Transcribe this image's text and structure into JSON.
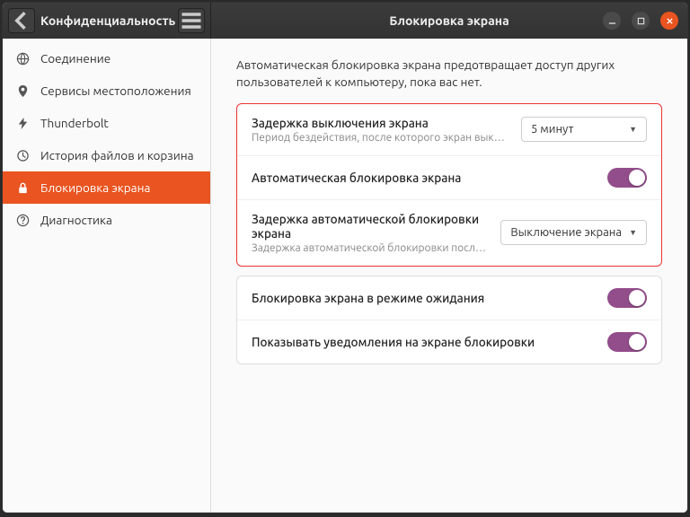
{
  "titlebar": {
    "section_title": "Конфиденциальность",
    "page_title": "Блокировка экрана"
  },
  "sidebar": {
    "items": [
      {
        "label": "Соединение",
        "icon": "globe"
      },
      {
        "label": "Сервисы местоположения",
        "icon": "location"
      },
      {
        "label": "Thunderbolt",
        "icon": "thunderbolt"
      },
      {
        "label": "История файлов и корзина",
        "icon": "history"
      },
      {
        "label": "Блокировка экрана",
        "icon": "lock",
        "active": true
      },
      {
        "label": "Диагностика",
        "icon": "help"
      }
    ]
  },
  "content": {
    "description": "Автоматическая блокировка экрана предотвращает доступ других пользователей к компьютеру, пока вас нет.",
    "rows": [
      {
        "title": "Задержка выключения экрана",
        "subtitle": "Период бездействия, после которого экран выключится.",
        "control": "dropdown",
        "value": "5 минут"
      },
      {
        "title": "Автоматическая блокировка экрана",
        "control": "switch",
        "value": true
      },
      {
        "title": "Задержка автоматической блокировки экрана",
        "subtitle": "Задержка автоматической блокировки после отключен…",
        "control": "dropdown",
        "value": "Выключение экрана"
      },
      {
        "title": "Блокировка экрана в режиме ожидания",
        "control": "switch",
        "value": true
      },
      {
        "title": "Показывать уведомления на экране блокировки",
        "control": "switch",
        "value": true
      }
    ]
  },
  "colors": {
    "accent": "#e95420",
    "switch_on": "#924d8b",
    "highlight_border": "#e33"
  }
}
